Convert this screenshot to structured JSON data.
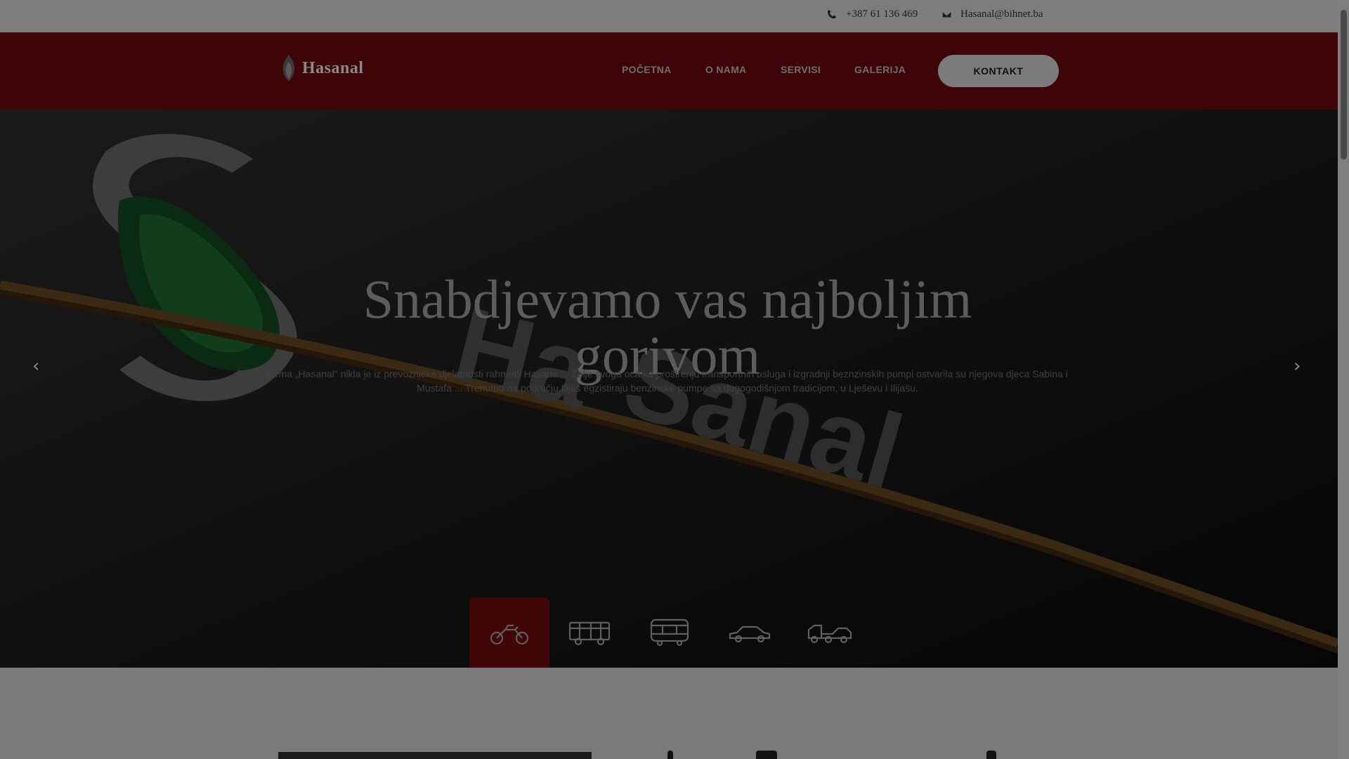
{
  "topbar": {
    "phone": "+387 61 136 469",
    "email": "Hasanal@bihnet.ba",
    "phone_icon": "phone-icon",
    "email_icon": "envelope-icon"
  },
  "nav": {
    "logo_text": "Hasanal",
    "items": [
      {
        "label": "POČETNA"
      },
      {
        "label": "O NAMA"
      },
      {
        "label": "SERVISI"
      },
      {
        "label": "GALERIJA"
      }
    ],
    "cta_label": "KONTAKT"
  },
  "hero": {
    "headline": "Snabdjevamo vas najboljim gorivom",
    "description": "Firma „Hasanal\" nikla je iz prevozničke djelatnosti rahmetli Hasana ... Želje svoga oca ka proširenju transportnih usluga i izgradnji beznzinskih pumpi ostvarila su njegova djeca Sabina i Mustafa ... Trenutno na području Ilijaš egzistiraju benzinske pumpe sa dugogodišnjom tradicijom, u Lješevu i Ilijašu.",
    "prev_icon": "chevron-left-icon",
    "next_icon": "chevron-right-icon",
    "tabs": [
      {
        "icon": "motorcycle-icon",
        "active": true
      },
      {
        "icon": "truck-icon",
        "active": false
      },
      {
        "icon": "bus-icon",
        "active": false
      },
      {
        "icon": "car-icon",
        "active": false
      },
      {
        "icon": "tow-truck-icon",
        "active": false
      }
    ]
  },
  "colors": {
    "nav_bg": "#3e0508",
    "active_tab": "#400507",
    "overlay": "#7a7a7a"
  }
}
